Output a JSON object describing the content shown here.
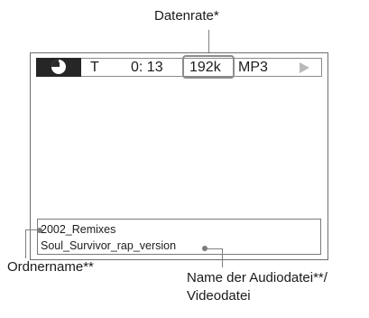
{
  "callouts": {
    "top": "Datenrate*",
    "bottom_left": "Ordnername**",
    "bottom_right_line1": "Name der Audiodatei**/",
    "bottom_right_line2": "Videodatei"
  },
  "status_bar": {
    "icon": "clock-icon",
    "mode": "T",
    "time": "0: 13",
    "bitrate": "192k",
    "format": "MP3",
    "play_icon": "play-triangle-icon"
  },
  "info": {
    "folder": "2002_Remixes",
    "file": "Soul_Survivor_rap_version"
  },
  "colors": {
    "status_dark": "#262626",
    "frame": "#6e6e6e",
    "callout": "#808080"
  }
}
